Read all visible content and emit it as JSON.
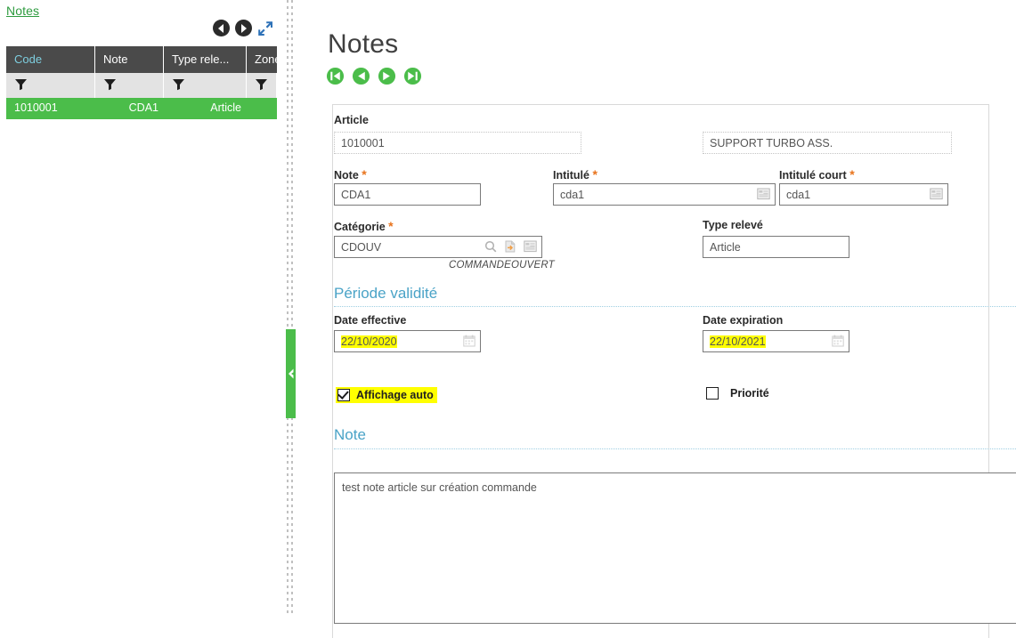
{
  "left_panel": {
    "breadcrumb": "Notes",
    "toolbar": {
      "prev_icon": "prev-circle-icon",
      "next_icon": "next-circle-icon",
      "expand_icon": "expand-diagonal-icon"
    },
    "grid": {
      "columns": [
        "Code",
        "Note",
        "Type rele...",
        "Zone"
      ],
      "sorted_column": "Code",
      "filter_icon": "funnel-filter-icon",
      "rows": [
        {
          "code": "1010001",
          "note": "CDA1",
          "type_releve": "Article",
          "zone": ""
        }
      ]
    }
  },
  "splitter": {
    "collapse_icon": "chevron-left-icon"
  },
  "main": {
    "title": "Notes",
    "record_nav": {
      "first": "first-record-icon",
      "previous": "previous-record-icon",
      "next": "next-record-icon",
      "last": "last-record-icon"
    },
    "fields": {
      "article_label": "Article",
      "article_code": "1010001",
      "article_desc": "SUPPORT TURBO ASS.",
      "note_label": "Note",
      "note_value": "CDA1",
      "intitule_label": "Intitulé",
      "intitule_value": "cda1",
      "intitule_court_label": "Intitulé court",
      "intitule_court_value": "cda1",
      "categorie_label": "Catégorie",
      "categorie_value": "CDOUV",
      "categorie_hint": "COMMANDEOUVERT",
      "type_releve_label": "Type relevé",
      "type_releve_value": "Article",
      "search_icon": "search-magnifier-icon",
      "lookup_icon": "page-jump-icon",
      "list_icon": "list-detail-icon",
      "editor_icon": "text-editor-icon"
    },
    "periode_validite": {
      "heading": "Période validité",
      "date_effective_label": "Date effective",
      "date_effective_value": "22/10/2020",
      "date_expiration_label": "Date expiration",
      "date_expiration_value": "22/10/2021",
      "calendar_icon": "calendar-icon"
    },
    "options": {
      "affichage_auto_label": "Affichage auto",
      "affichage_auto_checked": true,
      "priorite_label": "Priorité",
      "priorite_checked": false
    },
    "note_section": {
      "heading": "Note",
      "text": "test note article sur création commande"
    }
  },
  "colors": {
    "brand_green": "#4bbd4a",
    "link_green": "#2e9b3f",
    "section_blue": "#4aa3c7",
    "required_orange": "#e8731c",
    "grid_header_dark": "#4a4a4a",
    "highlight_yellow": "#ffff00",
    "sorted_column_teal": "#7ecfe0"
  }
}
